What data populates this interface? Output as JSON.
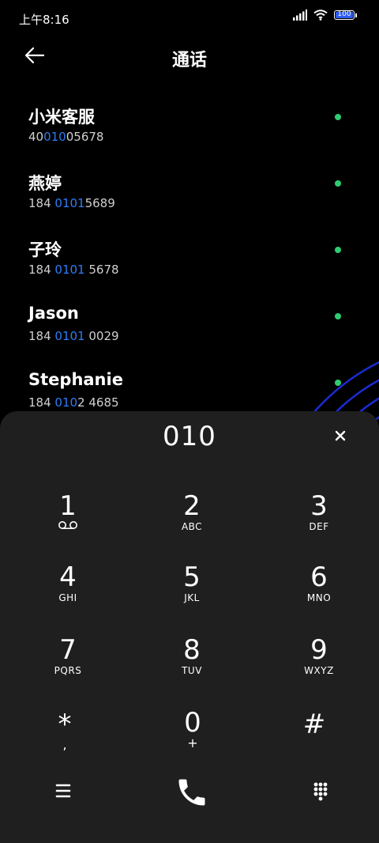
{
  "status_bar": {
    "time": "上午8:16",
    "battery": "100",
    "battery_level": 1.0,
    "icons": [
      "signal-icon",
      "wifi-icon",
      "battery-icon"
    ]
  },
  "header": {
    "title": "通话",
    "back_icon": "arrow-left-icon"
  },
  "contacts": [
    {
      "name": "小米客服",
      "number_pre": "40",
      "number_hl": "010",
      "number_post": "05678"
    },
    {
      "name": "燕婷",
      "number_pre": "184 ",
      "number_hl": "0101",
      "number_post": "5689"
    },
    {
      "name": "子玲",
      "number_pre": "184 ",
      "number_hl": "0101",
      "number_post": " 5678"
    },
    {
      "name": "Jason",
      "number_pre": "184 ",
      "number_hl": "0101",
      "number_post": " 0029"
    },
    {
      "name": "Stephanie",
      "number_pre": "184 ",
      "number_hl": "010",
      "number_post": "2 4685"
    }
  ],
  "dialpad": {
    "display": "010",
    "clear_label": "×",
    "keys": [
      {
        "digit": "1",
        "letters": ""
      },
      {
        "digit": "2",
        "letters": "ABC"
      },
      {
        "digit": "3",
        "letters": "DEF"
      },
      {
        "digit": "4",
        "letters": "GHI"
      },
      {
        "digit": "5",
        "letters": "JKL"
      },
      {
        "digit": "6",
        "letters": "MNO"
      },
      {
        "digit": "7",
        "letters": "PQRS"
      },
      {
        "digit": "8",
        "letters": "TUV"
      },
      {
        "digit": "9",
        "letters": "WXYZ"
      },
      {
        "digit": "*",
        "letters": ","
      },
      {
        "digit": "0",
        "letters": "+"
      },
      {
        "digit": "#",
        "letters": ""
      }
    ],
    "bottom_icons": [
      "menu-icon",
      "phone-icon",
      "dialpad-grid-icon"
    ]
  },
  "colors": {
    "background": "#000000",
    "dialpad_bg": "#1f1f1f",
    "highlight": "#2e7cf6",
    "online_dot": "#2ecc71",
    "decor_arcs": "#1a2bd6"
  }
}
